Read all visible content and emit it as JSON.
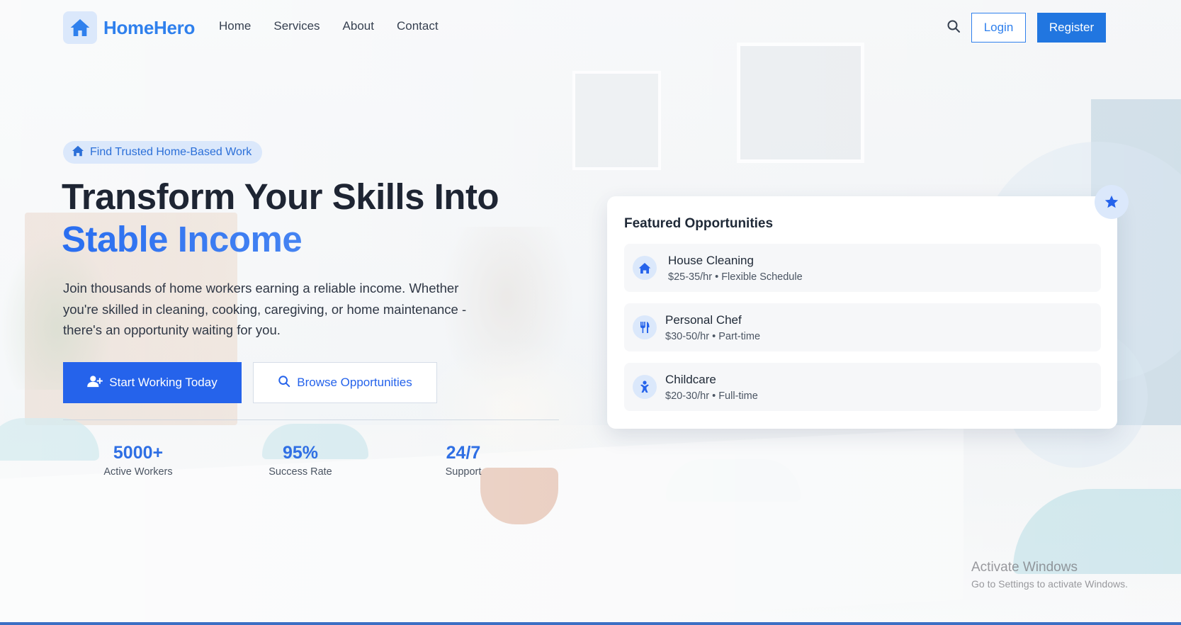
{
  "nav": {
    "brand": "HomeHero",
    "links": [
      "Home",
      "Services",
      "About",
      "Contact"
    ],
    "login_label": "Login",
    "register_label": "Register"
  },
  "hero": {
    "badge": "Find Trusted Home-Based Work",
    "title_line1": "Transform Your Skills Into",
    "title_line2": "Stable Income",
    "subtitle": "Join thousands of home workers earning a reliable income. Whether you're skilled in cleaning, cooking, caregiving, or home maintenance - there's an opportunity waiting for you.",
    "primary_cta": "Start Working Today",
    "secondary_cta": "Browse Opportunities",
    "stats": [
      {
        "value": "5000+",
        "label": "Active Workers"
      },
      {
        "value": "95%",
        "label": "Success Rate"
      },
      {
        "value": "24/7",
        "label": "Support"
      }
    ]
  },
  "featured": {
    "title": "Featured Opportunities",
    "items": [
      {
        "name": "House Cleaning",
        "meta": "$25-35/hr • Flexible Schedule",
        "icon": "home-icon"
      },
      {
        "name": "Personal Chef",
        "meta": "$30-50/hr • Part-time",
        "icon": "utensils-icon"
      },
      {
        "name": "Childcare",
        "meta": "$20-30/hr • Full-time",
        "icon": "child-icon"
      }
    ]
  },
  "watermark": {
    "line1": "Activate Windows",
    "line2": "Go to Settings to activate Windows."
  },
  "colors": {
    "accent": "#2563eb",
    "brand": "#2f80ed",
    "badge_bg": "#dbe8fb",
    "text_dark": "#1e2533"
  }
}
